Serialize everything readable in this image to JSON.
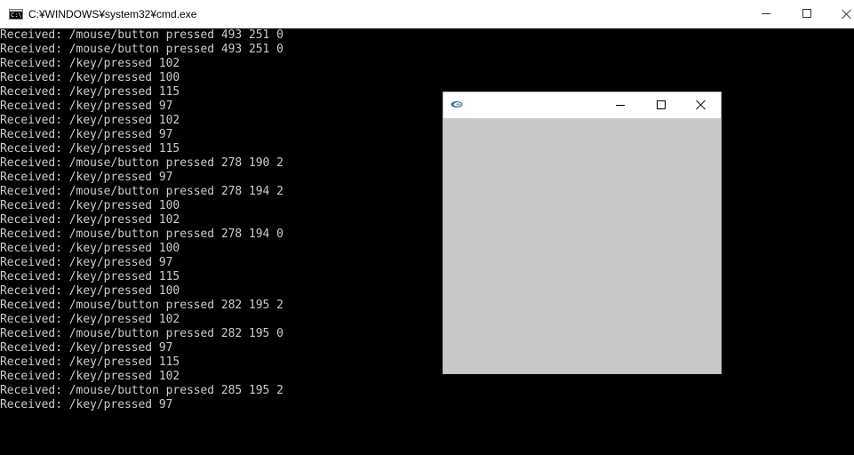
{
  "cmd_window": {
    "title": "C:¥WINDOWS¥system32¥cmd.exe",
    "icon": "cmd-icon",
    "icon_text": "C:\\."
  },
  "console": {
    "lines": [
      "Received: /mouse/button pressed 493 251 0",
      "Received: /mouse/button pressed 493 251 0",
      "Received: /key/pressed 102",
      "Received: /key/pressed 100",
      "Received: /key/pressed 115",
      "Received: /key/pressed 97",
      "Received: /key/pressed 102",
      "Received: /key/pressed 97",
      "Received: /key/pressed 115",
      "Received: /mouse/button pressed 278 190 2",
      "Received: /key/pressed 97",
      "Received: /mouse/button pressed 278 194 2",
      "Received: /key/pressed 100",
      "Received: /key/pressed 102",
      "Received: /mouse/button pressed 278 194 0",
      "Received: /key/pressed 100",
      "Received: /key/pressed 97",
      "Received: /key/pressed 115",
      "Received: /key/pressed 100",
      "Received: /mouse/button pressed 282 195 2",
      "Received: /key/pressed 102",
      "Received: /mouse/button pressed 282 195 0",
      "Received: /key/pressed 97",
      "Received: /key/pressed 115",
      "Received: /key/pressed 102",
      "Received: /mouse/button pressed 285 195 2",
      "Received: /key/pressed 97"
    ],
    "colors": {
      "background": "#000000",
      "text": "#cccccc"
    }
  },
  "app_window": {
    "icon": "processing-app-icon",
    "canvas_color": "#c8c8c8"
  }
}
